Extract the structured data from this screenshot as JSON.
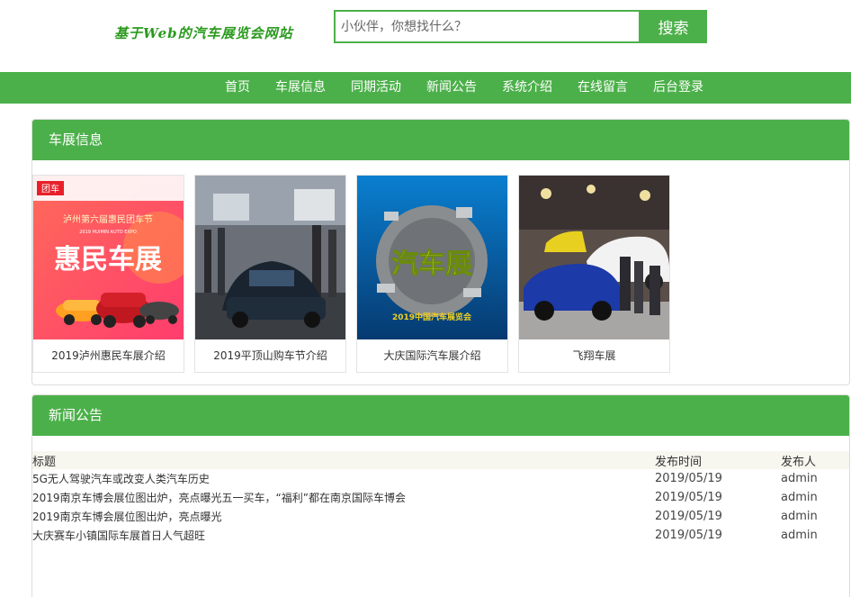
{
  "header": {
    "logo_text": "基于Web的汽车展览会网站",
    "search_placeholder": "小伙伴，你想找什么？",
    "search_button": "搜索"
  },
  "nav": {
    "items": [
      "首页",
      "车展信息",
      "同期活动",
      "新闻公告",
      "系统介绍",
      "在线留言",
      "后台登录"
    ]
  },
  "exhibitions": {
    "title": "车展信息",
    "cards": [
      {
        "title": "2019泸州惠民车展介绍",
        "image_banner": "泸州第六届惠民团车节",
        "image_sub": "2019 HUIMIN AUTO EXPO",
        "image_main": "惠民车展",
        "image_logo": "团车"
      },
      {
        "title": "2019平顶山购车节介绍"
      },
      {
        "title": "大庆国际汽车展介绍",
        "image_main": "汽车展",
        "image_sub": "2019中国汽车展览会"
      },
      {
        "title": "飞翔车展"
      }
    ]
  },
  "news": {
    "title": "新闻公告",
    "columns": [
      "标题",
      "发布时间",
      "发布人"
    ],
    "rows": [
      {
        "title": "5G无人驾驶汽车或改变人类汽车历史",
        "date": "2019/05/19",
        "author": "admin"
      },
      {
        "title": "2019南京车博会展位图出炉，亮点曝光五一买车，“福利”都在南京国际车博会",
        "date": "2019/05/19",
        "author": "admin"
      },
      {
        "title": "2019南京车博会展位图出炉，亮点曝光",
        "date": "2019/05/19",
        "author": "admin"
      },
      {
        "title": "大庆赛车小镇国际车展首日人气超旺",
        "date": "2019/05/19",
        "author": "admin"
      }
    ]
  },
  "colors": {
    "accent": "#4cb04a",
    "logo": "#2a9a1e",
    "table_header_bg": "#f7f6ef"
  }
}
